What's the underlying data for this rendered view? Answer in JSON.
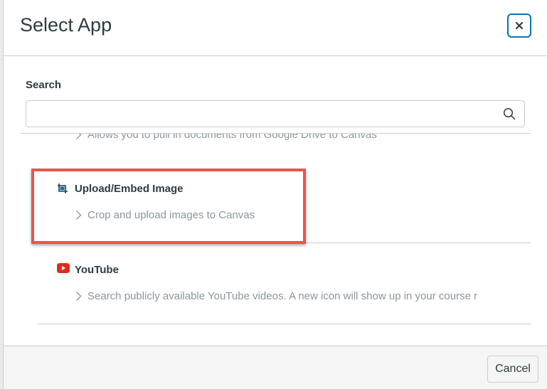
{
  "dialog": {
    "title": "Select App",
    "close_icon": "close-icon"
  },
  "search": {
    "label": "Search",
    "value": "",
    "placeholder": "",
    "icon": "search-icon"
  },
  "apps": [
    {
      "name": "",
      "description": "Allows you to pull in documents from Google Drive to Canvas",
      "icon": "chevron-right-icon"
    },
    {
      "name": "Upload/Embed Image",
      "description": "Crop and upload images to Canvas",
      "icon": "image-crop-icon",
      "highlighted": true,
      "highlight_color": "#e8554c"
    },
    {
      "name": "YouTube",
      "description": "Search publicly available YouTube videos. A new icon will show up in your course r",
      "icon": "youtube-icon",
      "icon_color": "#e02a20"
    }
  ],
  "footer": {
    "cancel_label": "Cancel"
  },
  "colors": {
    "accent": "#0374b5",
    "text": "#2d3b45",
    "muted": "#8b969e",
    "border": "#c7cdd1"
  }
}
